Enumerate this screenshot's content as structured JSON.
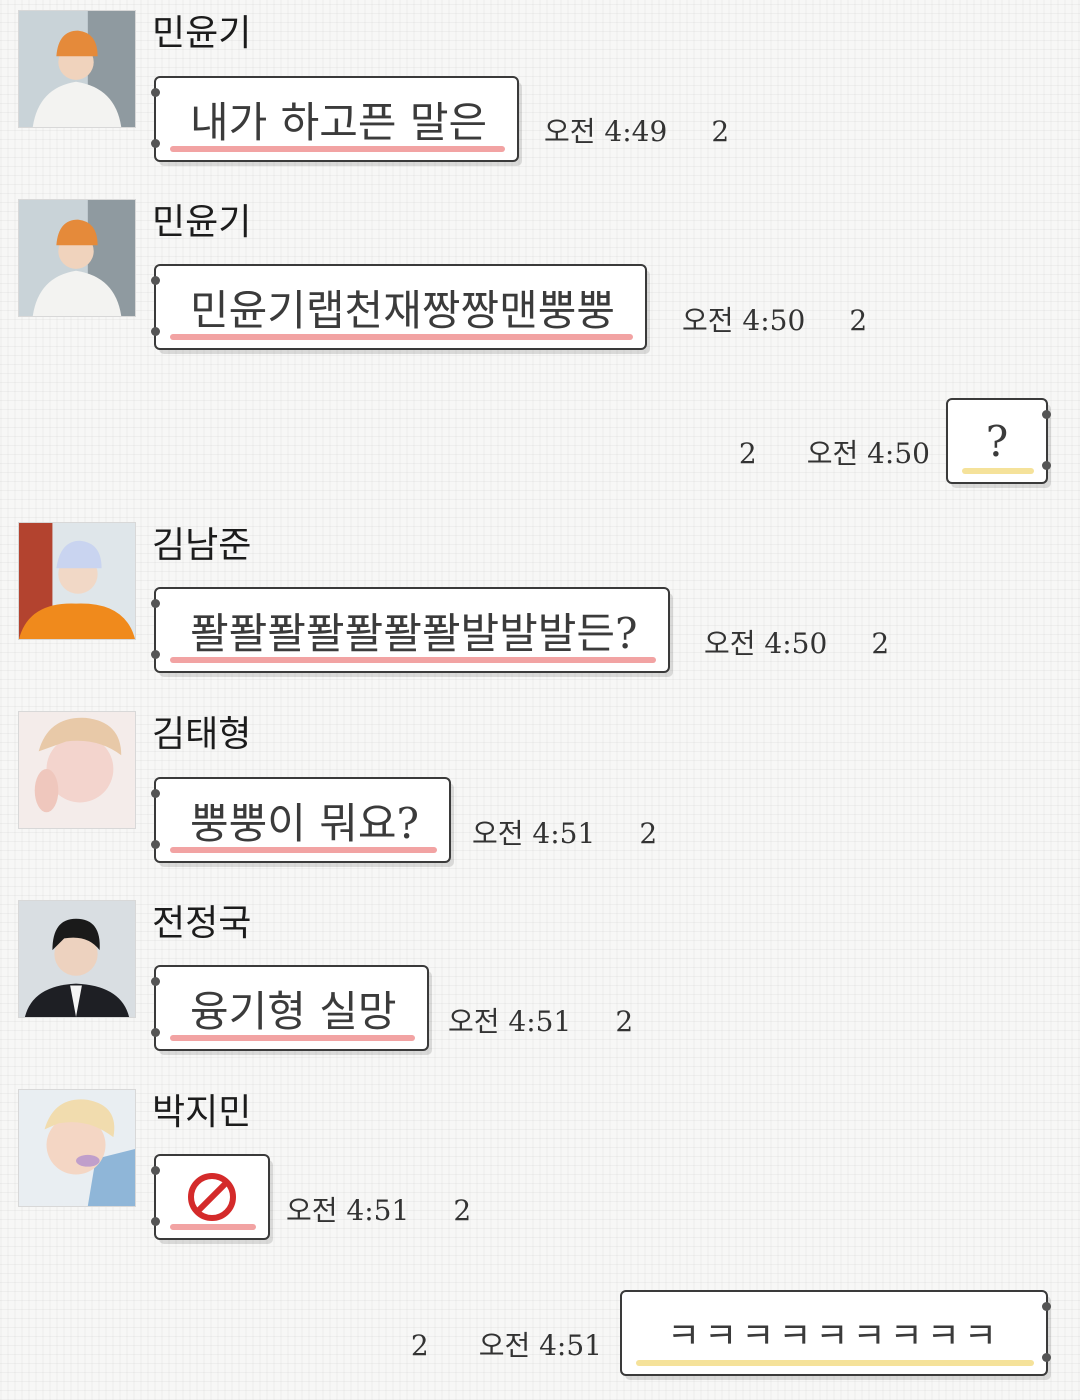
{
  "colors": {
    "highlight_in": "#f2a3a3",
    "highlight_out": "#f5e29a",
    "bubble_border": "#3a3a3a",
    "no_symbol": "#d42a2a"
  },
  "messages": [
    {
      "sender": "민윤기",
      "text": "내가 하고픈 말은",
      "time": "오전 4:49",
      "unread": "2"
    },
    {
      "sender": "민윤기",
      "text": "민윤기랩천재짱짱맨뿡뿡",
      "time": "오전 4:50",
      "unread": "2"
    },
    {
      "text": "?",
      "time": "오전 4:50",
      "unread": "2"
    },
    {
      "sender": "김남준",
      "text": "퐐퐐퐐퐐퐐퐐퐐발발발든?",
      "time": "오전 4:50",
      "unread": "2"
    },
    {
      "sender": "김태형",
      "text": "뿡뿡이 뭐요?",
      "time": "오전 4:51",
      "unread": "2"
    },
    {
      "sender": "전정국",
      "text": "융기형 실망",
      "time": "오전 4:51",
      "unread": "2"
    },
    {
      "sender": "박지민",
      "icon": "no-symbol-icon",
      "time": "오전 4:51",
      "unread": "2"
    },
    {
      "text": "ㅋㅋㅋㅋㅋㅋㅋㅋㅋ",
      "time": "오전 4:51",
      "unread": "2"
    }
  ]
}
